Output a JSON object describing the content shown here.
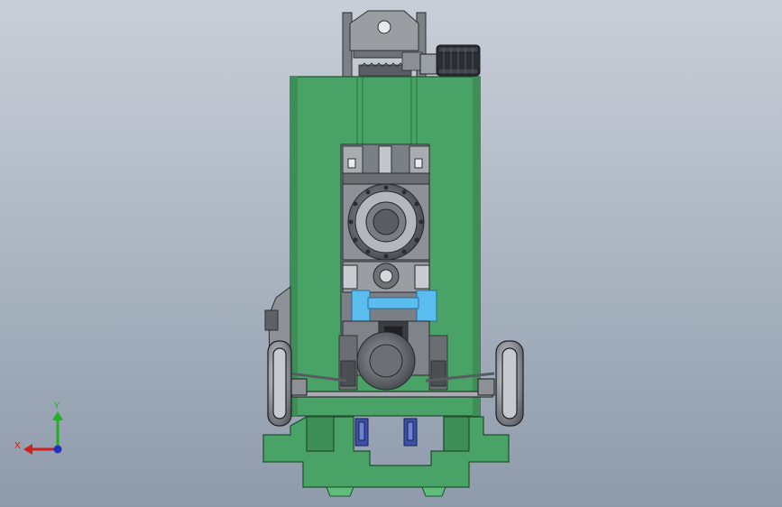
{
  "viewport": {
    "background_top": "#c9cfd8",
    "background_bottom": "#8e9bab"
  },
  "triad": {
    "x_label": "X",
    "y_label": "Y",
    "x_color": "#d02020",
    "y_color": "#20b020",
    "z_color": "#2030c0"
  },
  "colors": {
    "frame_green": "#4aa366",
    "frame_green_dark": "#2f7a46",
    "steel_grey": "#8a8f94",
    "steel_dark": "#4a4d52",
    "highlight_blue": "#5bbcf0",
    "motor_dark": "#2b2e33",
    "hydraulic_blue": "#3a4fa8"
  }
}
